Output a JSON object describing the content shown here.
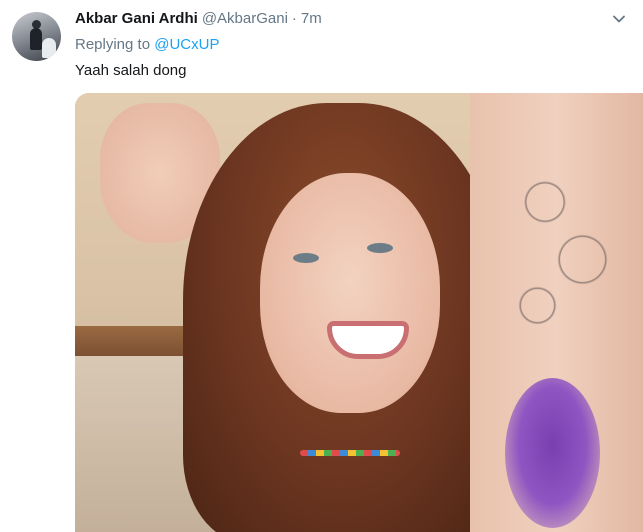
{
  "tweet": {
    "author_name": "Akbar Gani Ardhi",
    "author_handle": "@AkbarGani",
    "separator": "·",
    "time": "7m",
    "replying_prefix": "Replying to",
    "replying_to": "@UCxUP",
    "text": "Yaah salah dong"
  },
  "icons": {
    "avatar": "avatar",
    "caret": "chevron-down-icon"
  },
  "colors": {
    "name": "#14171a",
    "secondary": "#657786",
    "mention": "#1da1f2"
  }
}
